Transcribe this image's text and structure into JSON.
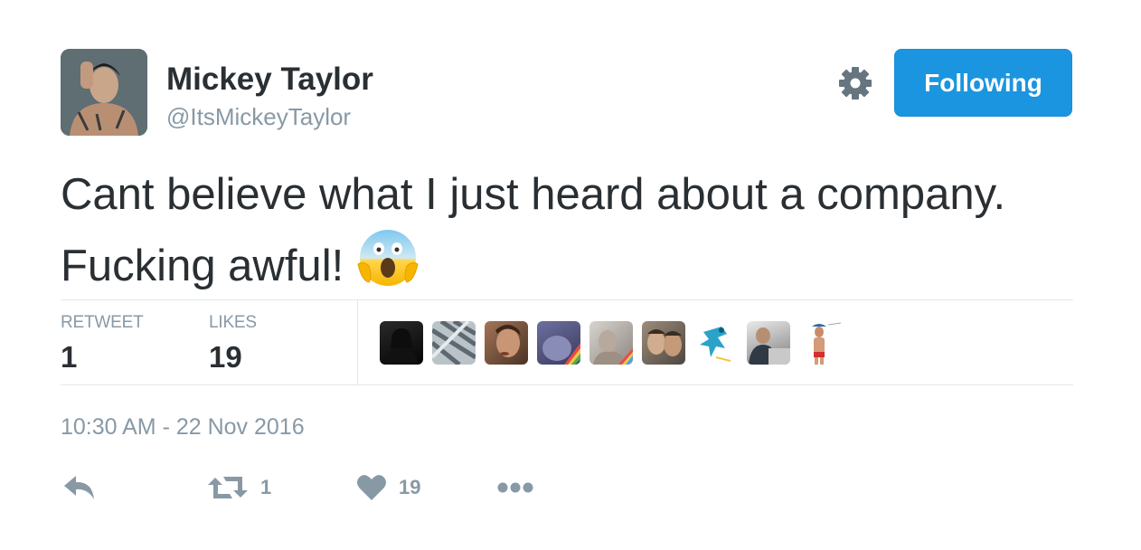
{
  "user": {
    "display_name": "Mickey Taylor",
    "screen_name": "@ItsMickeyTaylor"
  },
  "follow_button": {
    "label": "Following"
  },
  "tweet": {
    "line1": "Cant believe what I just heard about a company.",
    "line2": "Fucking awful!",
    "emoji": "face-screaming-in-fear-icon"
  },
  "stats": {
    "retweets_label": "RETWEET",
    "retweets_count": "1",
    "likes_label": "LIKES",
    "likes_count": "19"
  },
  "likers_count_shown": 9,
  "timestamp": "10:30 AM - 22 Nov 2016",
  "actions": {
    "reply_icon": "reply-icon",
    "retweet_icon": "retweet-icon",
    "retweet_count": "1",
    "like_icon": "heart-icon",
    "like_count": "19",
    "more_icon": "more-icon"
  },
  "colors": {
    "accent": "#1b95e0",
    "muted": "#8899a6",
    "text": "#292f33",
    "divider": "#e1e8ed"
  }
}
